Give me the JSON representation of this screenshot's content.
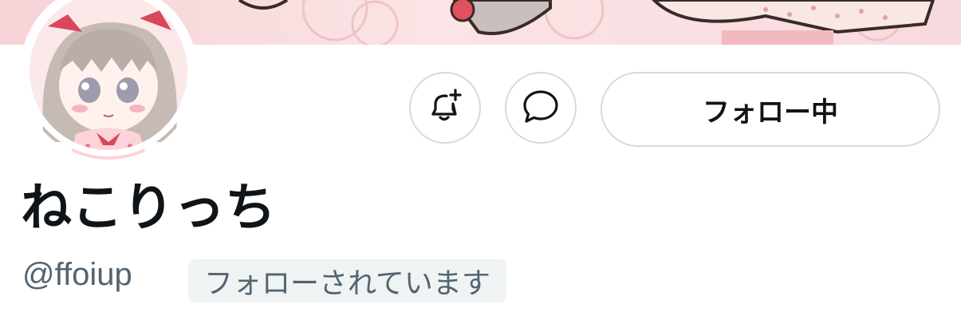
{
  "profile": {
    "display_name": "ねこりっち",
    "handle": "@ffoiup",
    "follows_you_badge": "フォローされています"
  },
  "actions": {
    "notify_icon": "bell-plus-icon",
    "message_icon": "message-bubble-icon",
    "follow_label": "フォロー中"
  },
  "colors": {
    "text_primary": "#0f1419",
    "text_secondary": "#536471",
    "border": "#d4dbe0",
    "badge_bg": "#eff3f4",
    "banner_pink": "#f6d3d6"
  }
}
